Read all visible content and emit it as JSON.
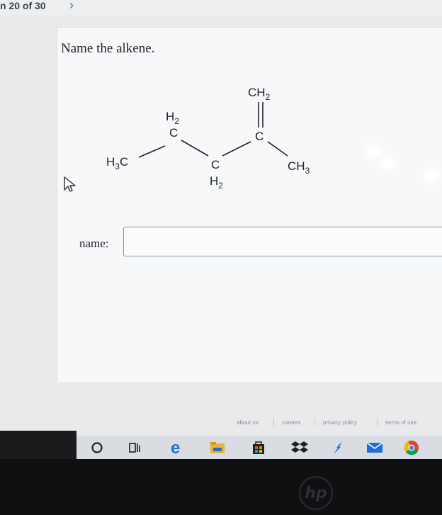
{
  "nav": {
    "counter": "n 20 of 30",
    "next_icon": "chevron-right-icon"
  },
  "question": {
    "prompt": "Name the alkene."
  },
  "molecule": {
    "groups": {
      "ch2_top": "CH",
      "ch2_top_sub": "2",
      "h2_left": "H",
      "h2_left_sub": "2",
      "c_left_upper": "C",
      "h3c_main": "H",
      "h3c_sub": "3",
      "h3c_c": "C",
      "c_middle_lower": "C",
      "h2_lower": "H",
      "h2_lower_sub": "2",
      "c_double": "C",
      "ch3_right": "CH",
      "ch3_right_sub": "3"
    }
  },
  "answer": {
    "label": "name:",
    "value": "",
    "placeholder": ""
  },
  "footer": {
    "links": [
      "about us",
      "careers",
      "privacy policy",
      "terms of use"
    ]
  },
  "taskbar": {
    "icons": [
      "search-circle-icon",
      "task-view-icon",
      "edge-icon",
      "file-explorer-icon",
      "store-icon",
      "dropbox-icon",
      "pinned-app-icon",
      "mail-icon",
      "chrome-icon"
    ]
  },
  "device": {
    "logo": "hp"
  }
}
